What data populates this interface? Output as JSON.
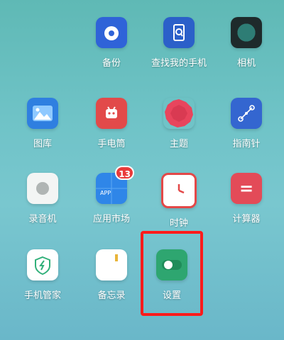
{
  "apps": [
    {
      "id": "backup",
      "label": "备份",
      "icon": "cloud-backup-icon"
    },
    {
      "id": "find_phone",
      "label": "查找我的手机",
      "icon": "find-phone-icon"
    },
    {
      "id": "camera",
      "label": "相机",
      "icon": "camera-icon"
    },
    {
      "id": "gallery",
      "label": "图库",
      "icon": "gallery-icon"
    },
    {
      "id": "flashlight",
      "label": "手电筒",
      "icon": "flashlight-icon"
    },
    {
      "id": "theme",
      "label": "主题",
      "icon": "theme-icon"
    },
    {
      "id": "compass",
      "label": "指南针",
      "icon": "compass-icon"
    },
    {
      "id": "recorder",
      "label": "录音机",
      "icon": "recorder-icon"
    },
    {
      "id": "app_market",
      "label": "应用市场",
      "icon": "app-market-icon",
      "badge": "13",
      "icon_text": "APP"
    },
    {
      "id": "clock",
      "label": "时钟",
      "icon": "clock-icon"
    },
    {
      "id": "calculator",
      "label": "计算器",
      "icon": "calculator-icon",
      "icon_text": "="
    },
    {
      "id": "phone_manager",
      "label": "手机管家",
      "icon": "phone-manager-icon"
    },
    {
      "id": "notes",
      "label": "备忘录",
      "icon": "notes-icon"
    },
    {
      "id": "settings",
      "label": "设置",
      "icon": "settings-toggle-icon"
    }
  ],
  "colors": {
    "highlight": "#ff1b1b",
    "badge": "#e93a3a"
  }
}
